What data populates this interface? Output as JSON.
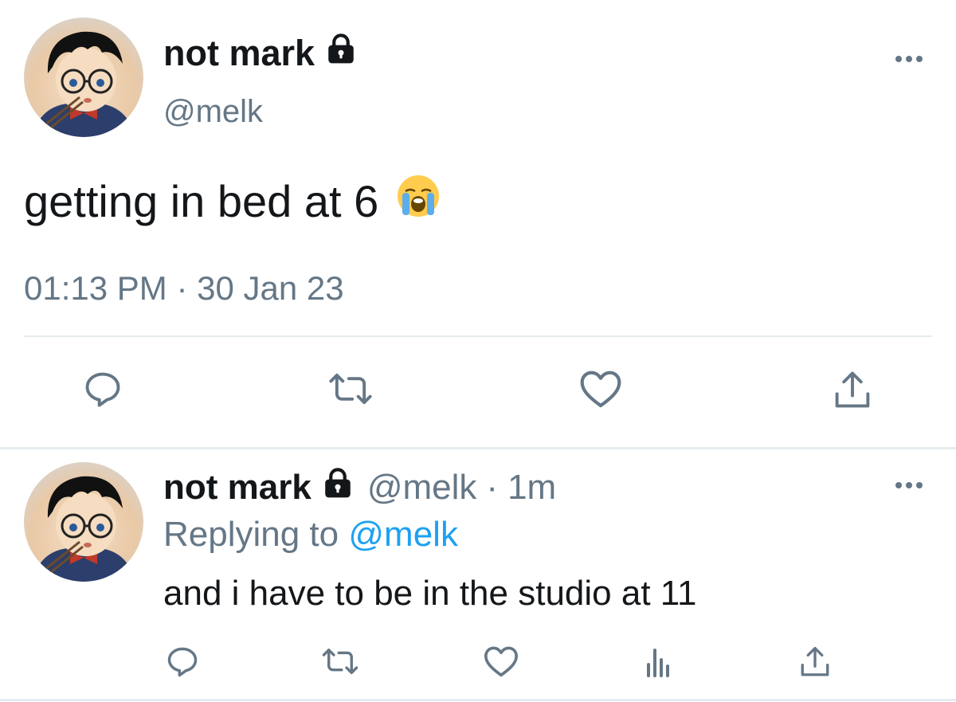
{
  "main_tweet": {
    "display_name": "not mark",
    "handle": "@melk",
    "text": "getting in bed at 6",
    "emoji": "loudly-crying-face-emoji",
    "timestamp": "01:13 PM · 30 Jan 23",
    "actions": [
      "reply-icon",
      "retweet-icon",
      "like-icon",
      "share-icon"
    ]
  },
  "reply_tweet": {
    "display_name": "not mark",
    "handle": "@melk",
    "separator": "·",
    "time": "1m",
    "replying_prefix": "Replying to",
    "replying_to": "@melk",
    "text": "and i have to be in the studio at 11",
    "actions": [
      "reply-icon",
      "retweet-icon",
      "like-icon",
      "analytics-icon",
      "share-icon"
    ]
  },
  "colors": {
    "text": "#14171a",
    "secondary": "#657786",
    "link": "#1da1f2",
    "divider": "#e6ecf0"
  }
}
